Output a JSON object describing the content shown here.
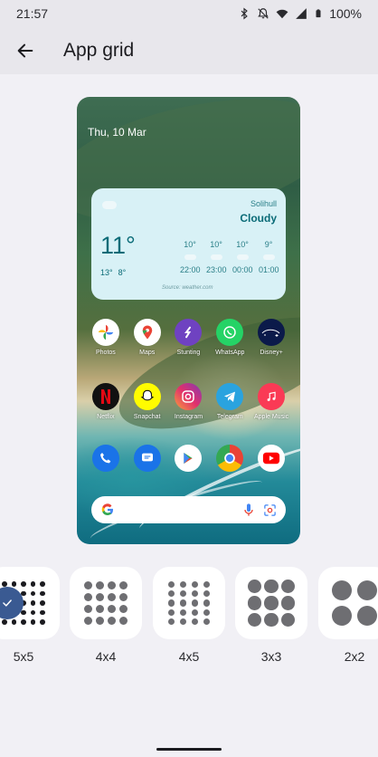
{
  "status": {
    "time": "21:57",
    "battery": "100%"
  },
  "app_bar": {
    "title": "App grid"
  },
  "preview": {
    "date": "Thu, 10 Mar",
    "weather": {
      "city": "Solihull",
      "condition": "Cloudy",
      "temp": "11°",
      "high": "13°",
      "low": "8°",
      "hours": [
        {
          "temp": "10°",
          "time": "22:00"
        },
        {
          "temp": "10°",
          "time": "23:00"
        },
        {
          "temp": "10°",
          "time": "00:00"
        },
        {
          "temp": "9°",
          "time": "01:00"
        }
      ],
      "source": "Source: weather.com"
    },
    "apps_row1": [
      "Photos",
      "Maps",
      "Stunting",
      "WhatsApp",
      "Disney+"
    ],
    "apps_row2": [
      "Netflix",
      "Snapchat",
      "Instagram",
      "Telegram",
      "Apple Music"
    ]
  },
  "grid_options": [
    {
      "label": "5x5",
      "selected": true
    },
    {
      "label": "4x4",
      "selected": false
    },
    {
      "label": "4x5",
      "selected": false
    },
    {
      "label": "3x3",
      "selected": false
    },
    {
      "label": "2x2",
      "selected": false
    }
  ],
  "colors": {
    "accent": "#3a5a92",
    "dot": "#6e6e72",
    "weather_text": "#0a6b77"
  }
}
